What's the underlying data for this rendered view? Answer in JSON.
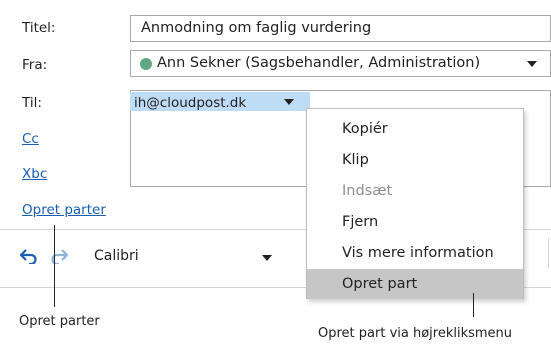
{
  "form": {
    "titel_label": "Titel:",
    "titel_value": "Anmodning om faglig vurdering",
    "fra_label": "Fra:",
    "fra_value": "Ann Sekner (Sagsbehandler, Administration)",
    "til_label": "Til:",
    "til_recipient": "ih@cloudpost.dk",
    "cc_label": "Cc",
    "xbc_label": "Xbc",
    "opret_parter_link": "Opret parter"
  },
  "toolbar": {
    "font_name": "Calibri"
  },
  "context_menu": {
    "items": [
      {
        "label": "Kopiér",
        "state": "normal"
      },
      {
        "label": "Klip",
        "state": "normal"
      },
      {
        "label": "Indsæt",
        "state": "disabled"
      },
      {
        "label": "Fjern",
        "state": "normal"
      },
      {
        "label": "Vis mere information",
        "state": "normal"
      },
      {
        "label": "Opret part",
        "state": "highlighted"
      }
    ]
  },
  "annotations": {
    "left": "Opret parter",
    "right": "Opret part via højrekliksmenu"
  },
  "colors": {
    "status_dot": "#5fa882",
    "recipient_highlight": "#bfdcf7",
    "link": "#1a5fb4",
    "menu_hover": "#c6c6c6"
  }
}
